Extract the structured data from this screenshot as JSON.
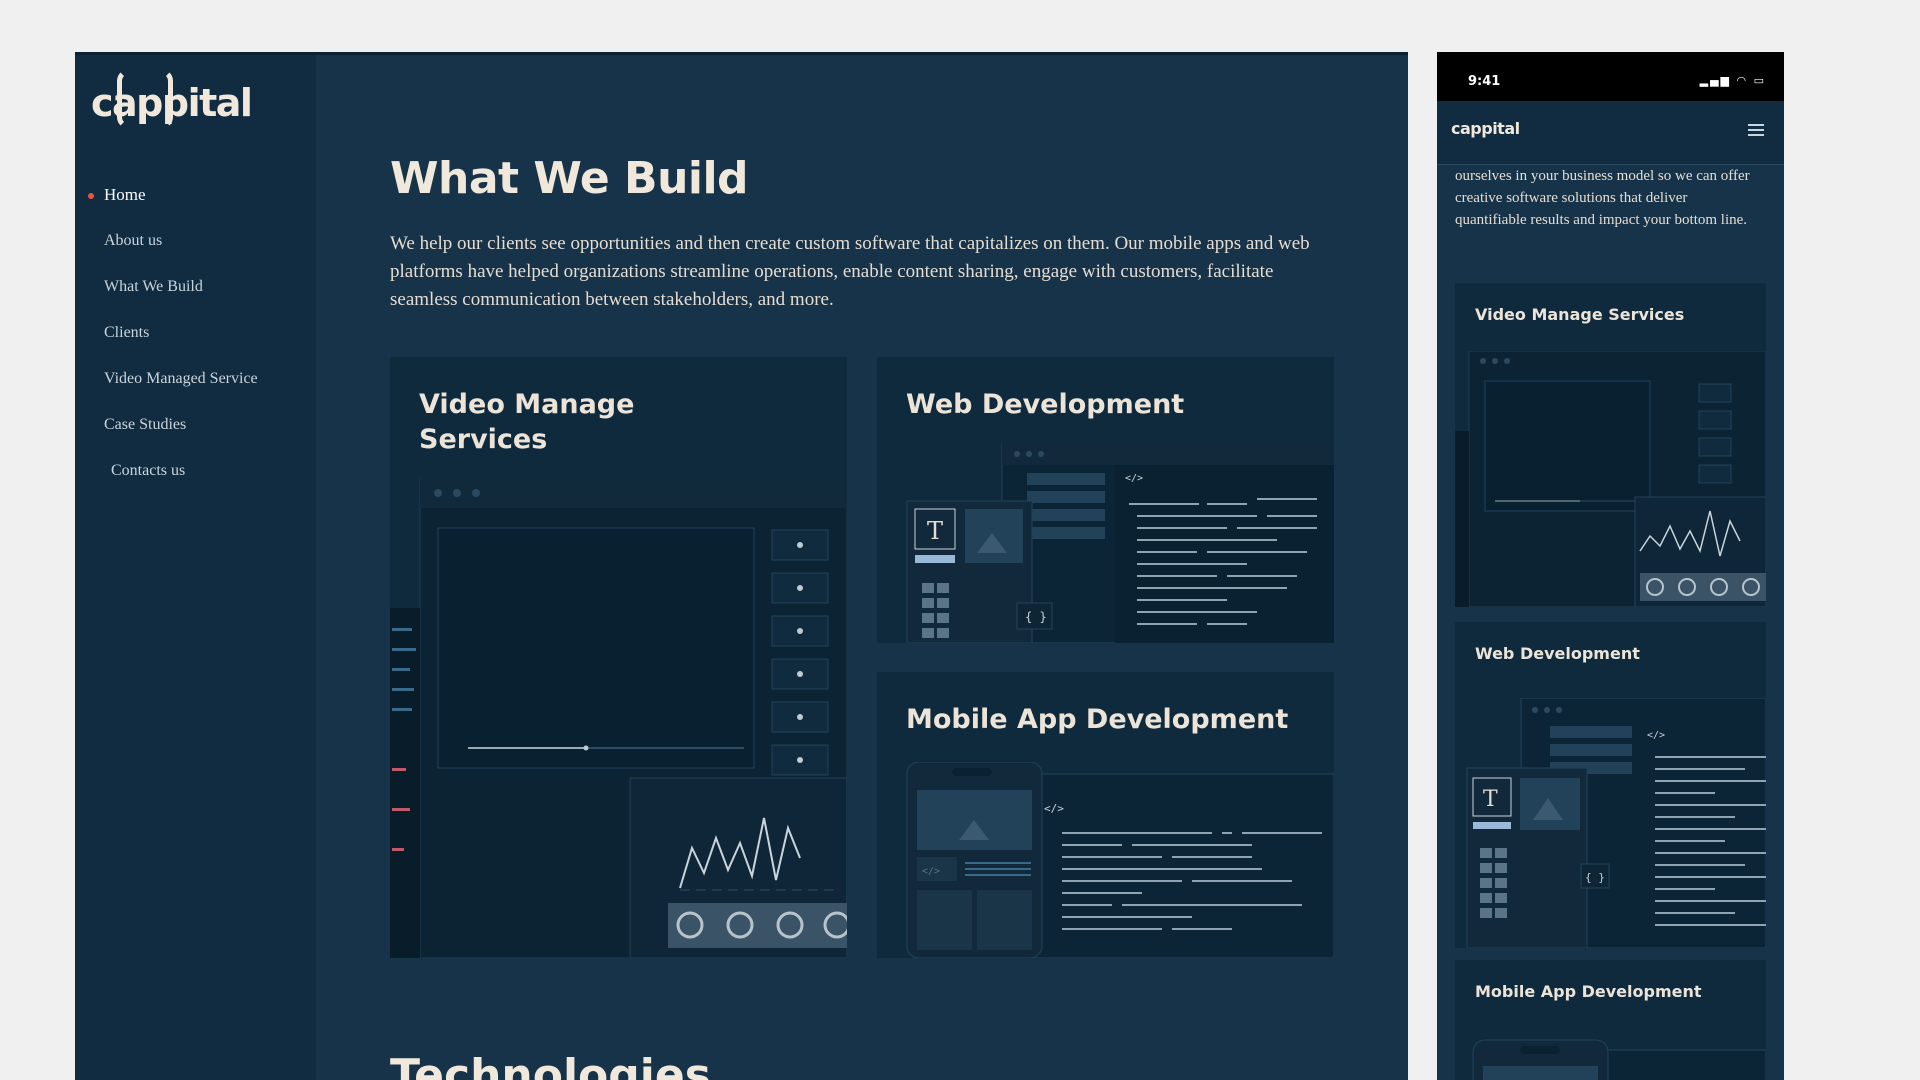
{
  "brand": {
    "logo_text": "cappital"
  },
  "nav": {
    "items": [
      {
        "label": "Home"
      },
      {
        "label": "About us"
      },
      {
        "label": "What We Build"
      },
      {
        "label": "Clients"
      },
      {
        "label": "Video Managed Service"
      },
      {
        "label": "Case Studies"
      },
      {
        "label": "Contacts us"
      }
    ],
    "active": "Home"
  },
  "main": {
    "title": "What We Build",
    "intro": "We help our clients see opportunities and then create custom software that capitalizes on them. Our mobile apps and web platforms have helped organizations streamline operations, enable content sharing, engage with customers, facilitate seamless communication between stakeholders, and more.",
    "cards": [
      {
        "title": "Video Manage Services"
      },
      {
        "title": "Web Development"
      },
      {
        "title": "Mobile App Development"
      }
    ],
    "next_section": "Technologies"
  },
  "mobile": {
    "time": "9:41",
    "logo_text": "cappital",
    "intro_tail": "ourselves in your business model so we can offer creative software solutions that deliver quantifiable results and impact your bottom line.",
    "cards": [
      {
        "title": "Video Manage Services"
      },
      {
        "title": "Web Development"
      },
      {
        "title": "Mobile App Development"
      }
    ]
  },
  "colors": {
    "background": "#163349",
    "sidebar": "#112c40",
    "accent_dot": "#e8553f",
    "heading": "#f1e8dc"
  }
}
